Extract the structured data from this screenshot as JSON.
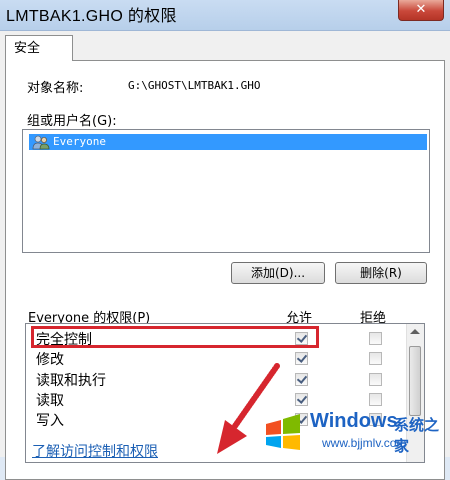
{
  "window": {
    "title": "LMTBAK1.GHO 的权限",
    "close_glyph": "✕"
  },
  "tab": {
    "label": "安全"
  },
  "object": {
    "label": "对象名称:",
    "value": "G:\\GHOST\\LMTBAK1.GHO"
  },
  "users": {
    "label": "组或用户名(G):",
    "items": [
      {
        "name": "Everyone",
        "icon": "users-icon",
        "selected": true
      }
    ]
  },
  "buttons": {
    "add": "添加(D)...",
    "remove": "删除(R)"
  },
  "permissions": {
    "label": "Everyone 的权限(P)",
    "allow_header": "允许",
    "deny_header": "拒绝",
    "rows": [
      {
        "name": "完全控制",
        "allow": true,
        "deny": false
      },
      {
        "name": "修改",
        "allow": true,
        "deny": false
      },
      {
        "name": "读取和执行",
        "allow": true,
        "deny": false
      },
      {
        "name": "读取",
        "allow": true,
        "deny": false
      },
      {
        "name": "写入",
        "allow": true,
        "deny": false
      }
    ]
  },
  "help_link": "了解访问控制和权限",
  "watermark": {
    "brand": "Windows",
    "cn": "系统之家",
    "url": "www.bjjmlv.com"
  },
  "colors": {
    "selection": "#3399ff",
    "highlight": "#d6262e",
    "link": "#1b5fb4"
  }
}
